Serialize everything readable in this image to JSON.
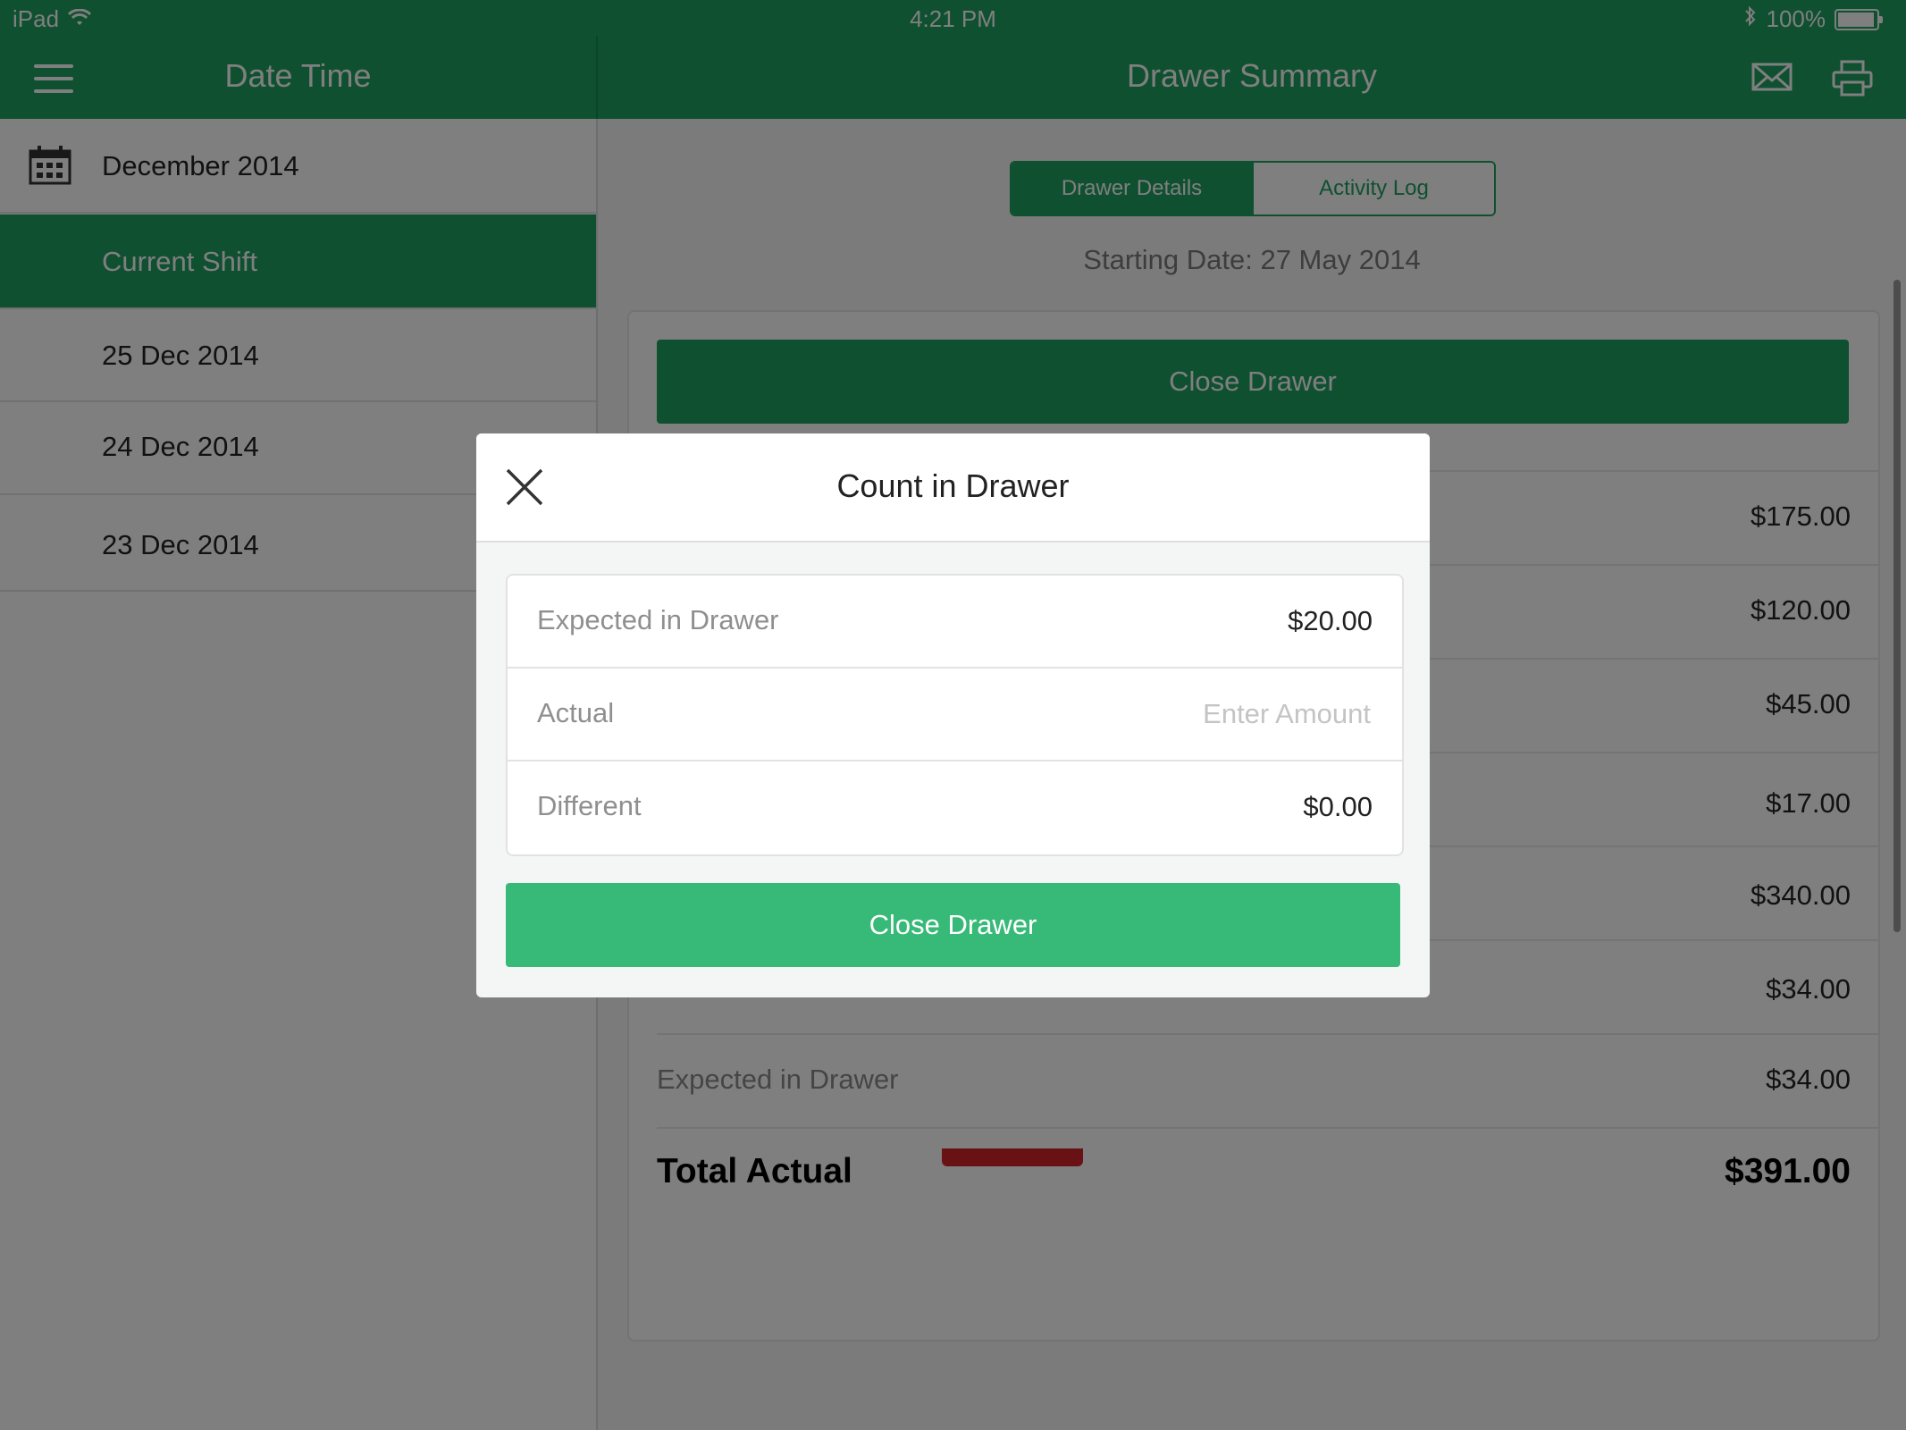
{
  "status_bar": {
    "device": "iPad",
    "time": "4:21 PM",
    "battery": "100%"
  },
  "left_nav": {
    "title": "Date Time"
  },
  "right_nav": {
    "title": "Drawer Summary"
  },
  "sidebar": {
    "month": "December 2014",
    "items": [
      {
        "label": "Current Shift"
      },
      {
        "label": "25 Dec 2014"
      },
      {
        "label": "24 Dec 2014"
      },
      {
        "label": "23 Dec 2014"
      }
    ]
  },
  "main": {
    "tabs": [
      {
        "label": "Drawer Details"
      },
      {
        "label": "Activity Log"
      }
    ],
    "starting_date": "Starting Date: 27 May 2014",
    "close_drawer_label": "Close Drawer",
    "amounts": [
      "$175.00",
      "$120.00",
      "$45.00",
      "$17.00",
      "$340.00",
      "$34.00"
    ],
    "expected_label": "Expected in Drawer",
    "expected_amount": "$34.00",
    "total_label": "Total Actual",
    "total_amount": "$391.00"
  },
  "modal": {
    "title": "Count in Drawer",
    "expected_label": "Expected in Drawer",
    "expected_value": "$20.00",
    "actual_label": "Actual",
    "actual_placeholder": "Enter Amount",
    "different_label": "Different",
    "different_value": "$0.00",
    "button_label": "Close Drawer"
  },
  "colors": {
    "primary": "#1fa060",
    "button": "#37b978",
    "alert": "#d0252c"
  }
}
